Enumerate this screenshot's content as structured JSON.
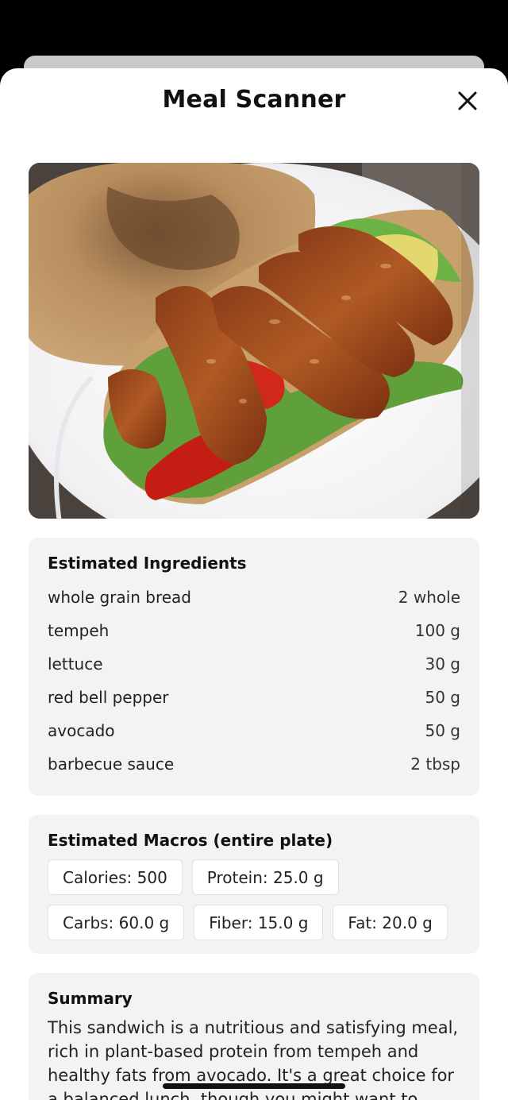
{
  "header": {
    "title": "Meal Scanner"
  },
  "photo": {
    "alt": "Open-faced sandwich with tempeh, lettuce, red bell pepper and avocado with barbecue sauce"
  },
  "ingredients": {
    "heading": "Estimated Ingredients",
    "items": [
      {
        "name": "whole grain bread",
        "qty": "2 whole"
      },
      {
        "name": "tempeh",
        "qty": "100 g"
      },
      {
        "name": "lettuce",
        "qty": "30 g"
      },
      {
        "name": "red bell pepper",
        "qty": "50 g"
      },
      {
        "name": "avocado",
        "qty": "50 g"
      },
      {
        "name": "barbecue sauce",
        "qty": "2 tbsp"
      }
    ]
  },
  "macros": {
    "heading": "Estimated Macros (entire plate)",
    "calories": "Calories: 500",
    "protein": "Protein: 25.0 g",
    "carbs": "Carbs: 60.0 g",
    "fiber": "Fiber: 15.0 g",
    "fat": "Fat: 20.0 g"
  },
  "summary": {
    "heading": "Summary",
    "text": "This sandwich is a nutritious and satisfying meal, rich in plant-based protein from tempeh and healthy fats from avocado. It's a great choice for a balanced lunch, though you might want to watch"
  },
  "icons": {
    "close": "close-icon"
  },
  "colors": {
    "card_bg": "#f2f3f5",
    "chip_border": "#e2e3e6",
    "sheet_bg": "#ffffff"
  }
}
